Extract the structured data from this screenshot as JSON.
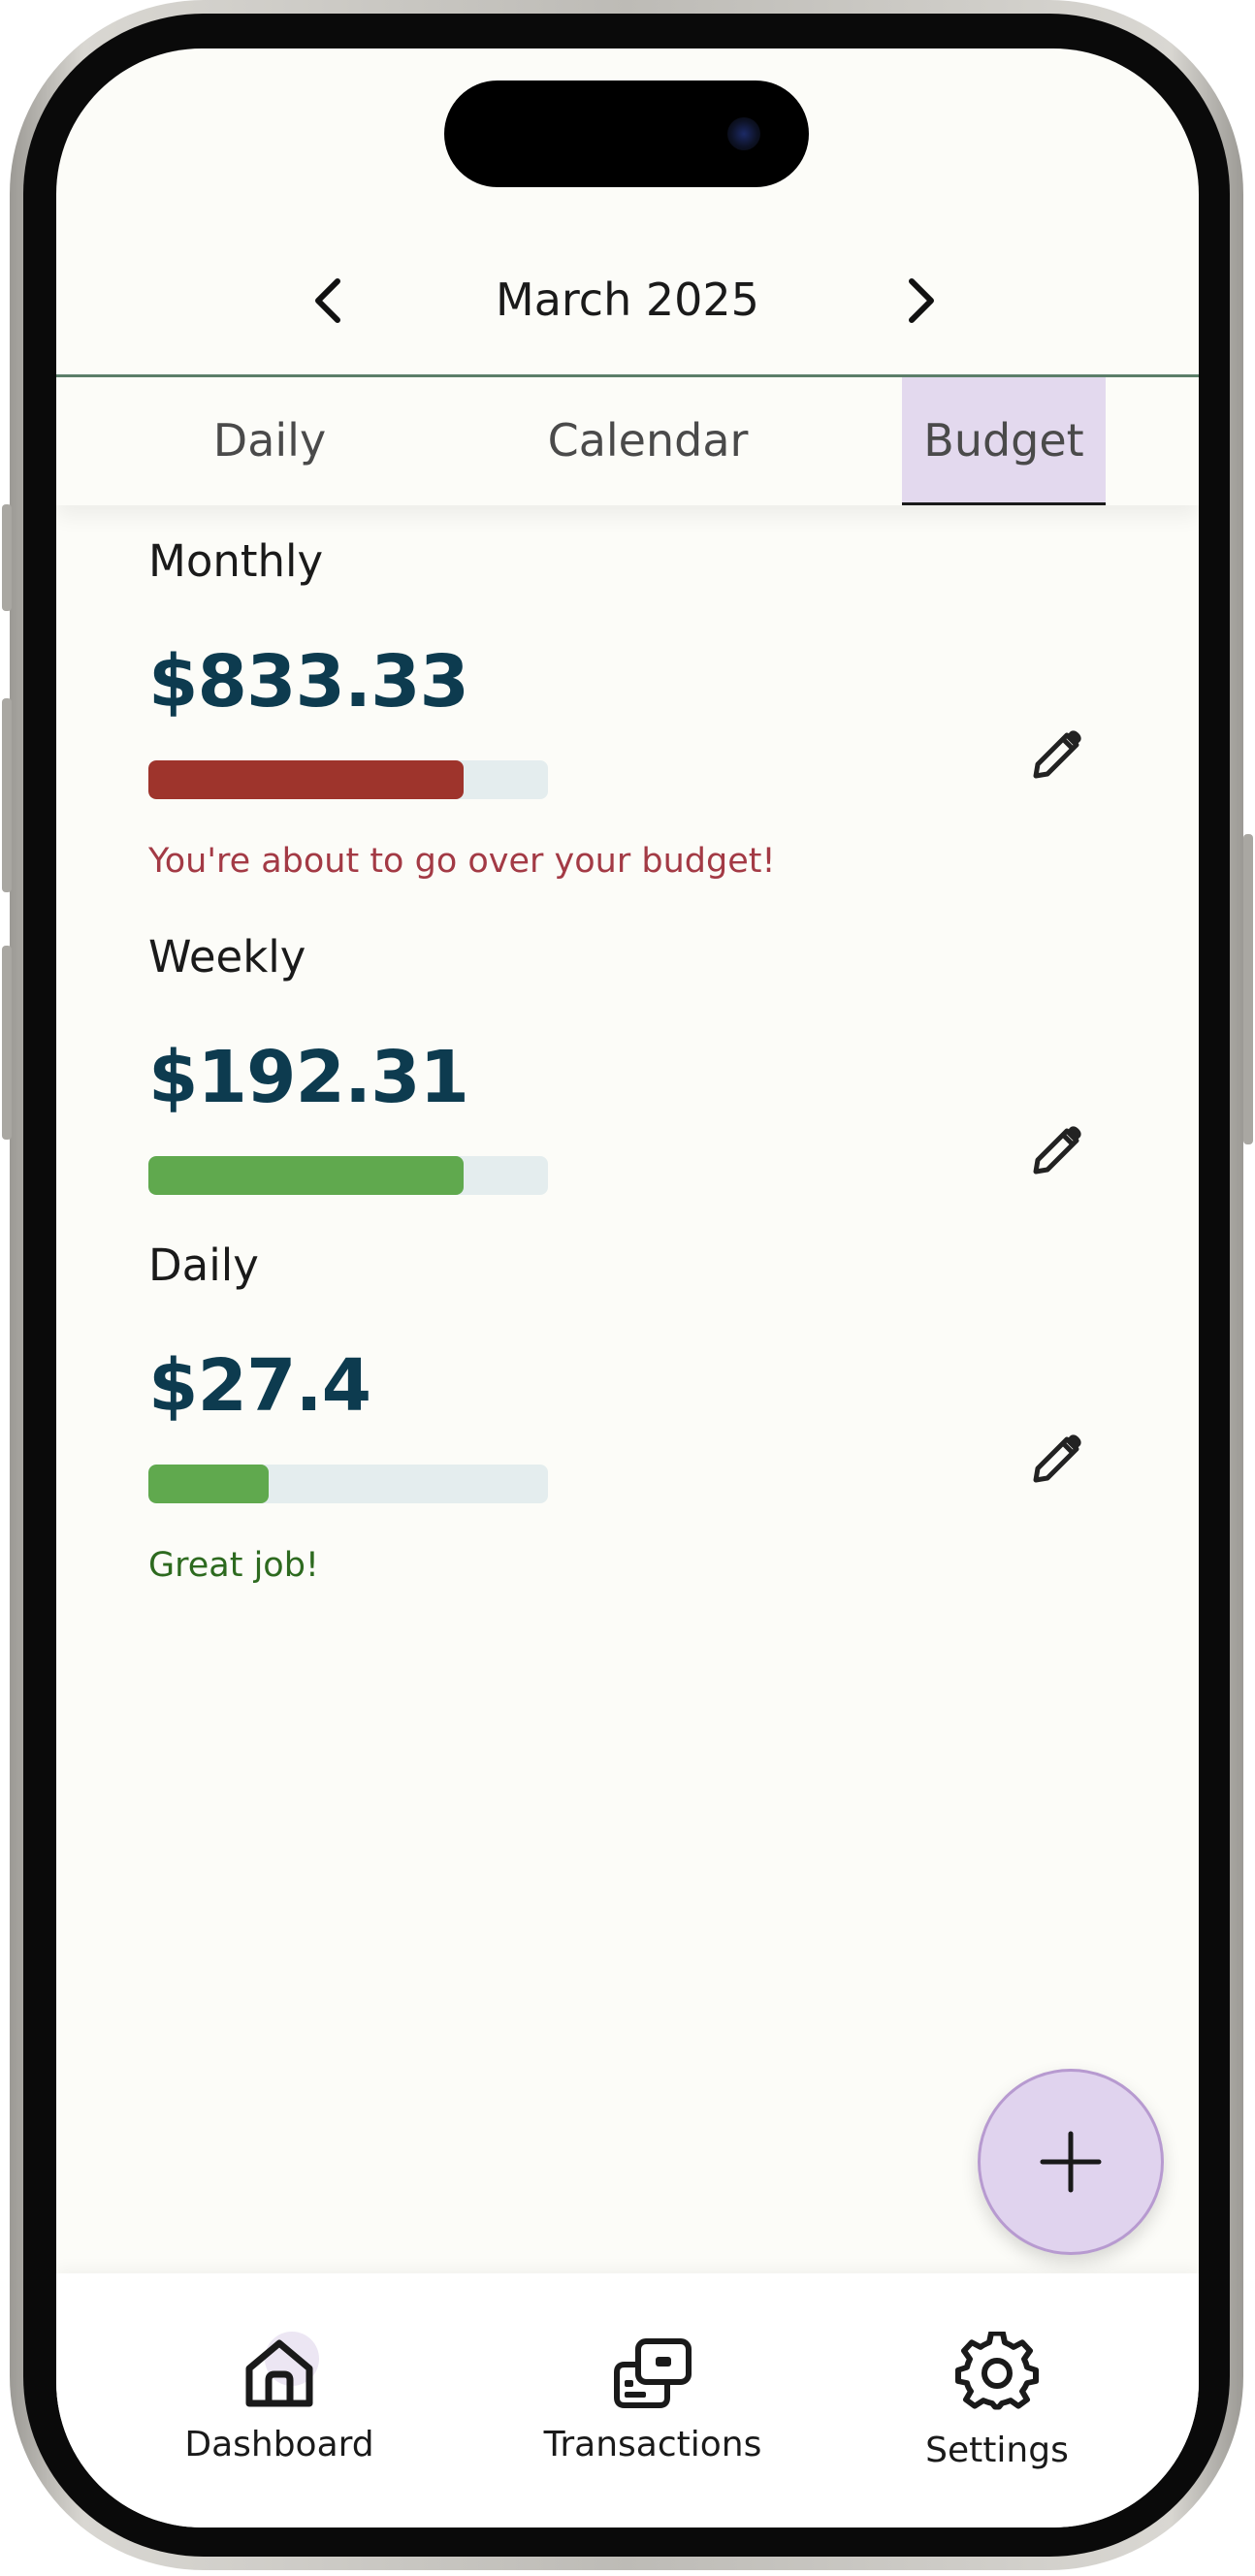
{
  "header": {
    "month": "March 2025",
    "prev_icon": "chevron-left-icon",
    "next_icon": "chevron-right-icon"
  },
  "tabs": [
    {
      "label": "Daily",
      "active": false
    },
    {
      "label": "Calendar",
      "active": false
    },
    {
      "label": "Budget",
      "active": true
    }
  ],
  "budgets": [
    {
      "label": "Monthly",
      "amount": "$833.33",
      "progress": 0.79,
      "bar_color": "#9e342c",
      "message": "You're about to go over your budget!",
      "message_color": "#a33a45"
    },
    {
      "label": "Weekly",
      "amount": "$192.31",
      "progress": 0.79,
      "bar_color": "#60a94e",
      "message": "",
      "message_color": ""
    },
    {
      "label": "Daily",
      "amount": "$27.4",
      "progress": 0.3,
      "bar_color": "#60a94e",
      "message": "Great job!",
      "message_color": "#2d6a1f"
    }
  ],
  "fab": {
    "icon": "plus-icon"
  },
  "bottom_nav": [
    {
      "label": "Dashboard",
      "icon": "home-icon"
    },
    {
      "label": "Transactions",
      "icon": "transactions-icon"
    },
    {
      "label": "Settings",
      "icon": "gear-icon"
    }
  ],
  "colors": {
    "accent": "#e3d9ee",
    "amount_text": "#0d3b4f",
    "background": "#fcfcf8"
  }
}
